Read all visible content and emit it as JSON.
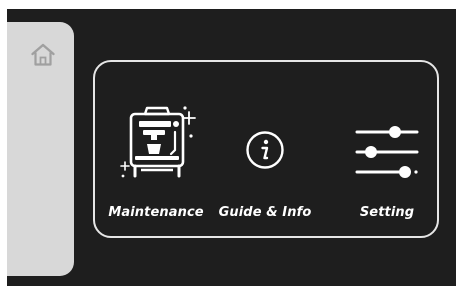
{
  "sidebar": {
    "home_icon": "home-icon"
  },
  "menu": {
    "items": [
      {
        "label": "Maintenance",
        "icon": "coffee-machine-icon"
      },
      {
        "label": "Guide & Info",
        "icon": "info-icon"
      },
      {
        "label": "Setting",
        "icon": "sliders-icon"
      }
    ]
  },
  "colors": {
    "background": "#1e1e1e",
    "sidebar": "#d8d8d8",
    "foreground": "#ffffff"
  }
}
